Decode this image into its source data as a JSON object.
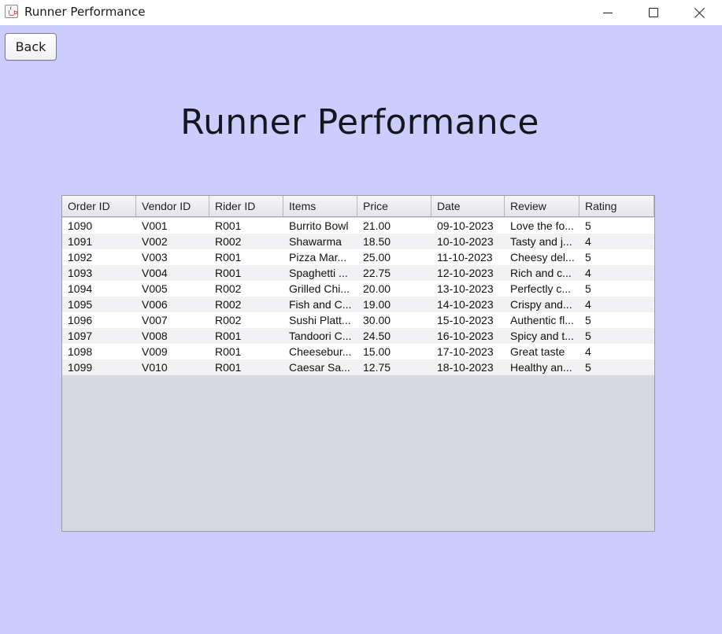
{
  "window": {
    "title": "Runner Performance",
    "controls": {
      "minimize": "minimize-icon",
      "maximize": "maximize-icon",
      "close": "close-icon"
    }
  },
  "toolbar": {
    "back_label": "Back"
  },
  "page": {
    "title": "Runner Performance"
  },
  "colors": {
    "background": "#ccccff",
    "table_empty": "#d6d9e2"
  },
  "table": {
    "columns": [
      "Order ID",
      "Vendor ID",
      "Rider ID",
      "Items",
      "Price",
      "Date",
      "Review",
      "Rating"
    ],
    "rows": [
      [
        "1090",
        "V001",
        "R001",
        "Burrito Bowl",
        "21.00",
        "09-10-2023",
        "Love the fo...",
        "5"
      ],
      [
        "1091",
        "V002",
        "R002",
        "Shawarma",
        "18.50",
        "10-10-2023",
        "Tasty and j...",
        "4"
      ],
      [
        "1092",
        "V003",
        "R001",
        "Pizza Mar...",
        "25.00",
        "11-10-2023",
        "Cheesy del...",
        "5"
      ],
      [
        "1093",
        "V004",
        "R001",
        "Spaghetti ...",
        "22.75",
        "12-10-2023",
        "Rich and c...",
        "4"
      ],
      [
        "1094",
        "V005",
        "R002",
        "Grilled Chi...",
        "20.00",
        "13-10-2023",
        "Perfectly c...",
        "5"
      ],
      [
        "1095",
        "V006",
        "R002",
        "Fish and C...",
        "19.00",
        "14-10-2023",
        "Crispy and...",
        "4"
      ],
      [
        "1096",
        "V007",
        "R002",
        "Sushi Platt...",
        "30.00",
        "15-10-2023",
        "Authentic fl...",
        "5"
      ],
      [
        "1097",
        "V008",
        "R001",
        "Tandoori C...",
        "24.50",
        "16-10-2023",
        "Spicy and t...",
        "5"
      ],
      [
        "1098",
        "V009",
        "R001",
        "Cheesebur...",
        "15.00",
        "17-10-2023",
        "Great taste",
        "4"
      ],
      [
        "1099",
        "V010",
        "R001",
        "Caesar Sa...",
        "12.75",
        "18-10-2023",
        "Healthy an...",
        "5"
      ]
    ]
  }
}
